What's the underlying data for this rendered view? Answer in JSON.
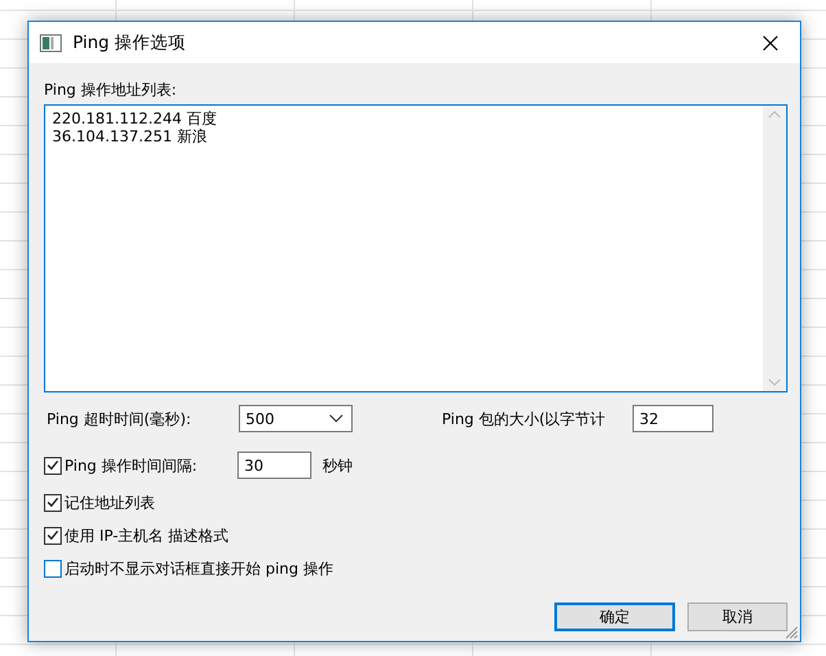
{
  "window": {
    "title": "Ping 操作选项"
  },
  "address_list": {
    "label": "Ping 操作地址列表:",
    "lines": [
      "220.181.112.244 百度",
      "36.104.137.251 新浪"
    ]
  },
  "timeout": {
    "label": "Ping 超时时间(毫秒):",
    "value": "500"
  },
  "packet_size": {
    "label": "Ping 包的大小(以字节计",
    "value": "32"
  },
  "interval": {
    "label": "Ping 操作时间间隔:",
    "checked": true,
    "value": "30",
    "unit": "秒钟"
  },
  "options": [
    {
      "label": "记住地址列表",
      "checked": true
    },
    {
      "label": "使用 IP-主机名 描述格式",
      "checked": true
    },
    {
      "label": "启动时不显示对话框直接开始 ping 操作",
      "checked": false
    }
  ],
  "buttons": [
    {
      "label": "确定",
      "default": true
    },
    {
      "label": "取消",
      "default": false
    }
  ]
}
